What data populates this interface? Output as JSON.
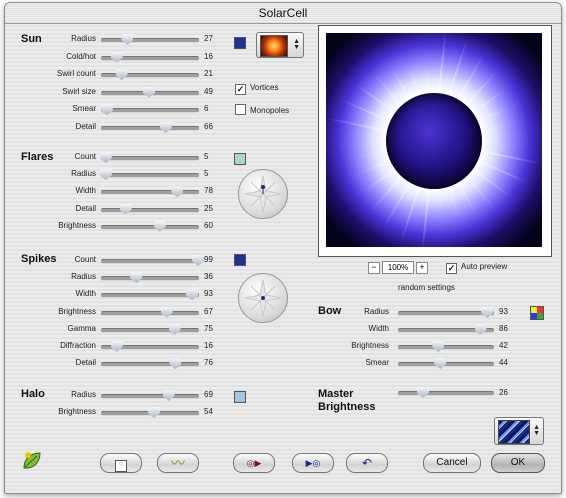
{
  "window": {
    "title": "SolarCell"
  },
  "sun": {
    "title": "Sun",
    "sliders": [
      {
        "label": "Radius",
        "value": "27",
        "level": 0.27
      },
      {
        "label": "Cold/hot",
        "value": "16",
        "level": 0.16
      },
      {
        "label": "Swirl count",
        "value": "21",
        "level": 0.21
      },
      {
        "label": "Swirl size",
        "value": "49",
        "level": 0.49
      },
      {
        "label": "Smear",
        "value": "6",
        "level": 0.06
      },
      {
        "label": "Detail",
        "value": "66",
        "level": 0.66
      }
    ],
    "swatch_color": "#1f2f9a",
    "vortices": {
      "label": "Vortices",
      "checked": true
    },
    "monopoles": {
      "label": "Monopoles",
      "checked": false
    }
  },
  "flares": {
    "title": "Flares",
    "sliders": [
      {
        "label": "Count",
        "value": "5",
        "level": 0.05
      },
      {
        "label": "Radius",
        "value": "5",
        "level": 0.05
      },
      {
        "label": "Width",
        "value": "78",
        "level": 0.78
      },
      {
        "label": "Detail",
        "value": "25",
        "level": 0.25
      },
      {
        "label": "Brightness",
        "value": "60",
        "level": 0.6
      }
    ],
    "swatch_color": "#a9d8c4"
  },
  "spikes": {
    "title": "Spikes",
    "sliders": [
      {
        "label": "Count",
        "value": "99",
        "level": 0.99
      },
      {
        "label": "Radius",
        "value": "36",
        "level": 0.36
      },
      {
        "label": "Width",
        "value": "93",
        "level": 0.93
      },
      {
        "label": "Brightness",
        "value": "67",
        "level": 0.67
      },
      {
        "label": "Gamma",
        "value": "75",
        "level": 0.75
      },
      {
        "label": "Diffraction",
        "value": "16",
        "level": 0.16
      },
      {
        "label": "Detail",
        "value": "76",
        "level": 0.76
      }
    ],
    "swatch_color": "#1f2f9a"
  },
  "halo": {
    "title": "Halo",
    "sliders": [
      {
        "label": "Radius",
        "value": "69",
        "level": 0.69
      },
      {
        "label": "Brightness",
        "value": "54",
        "level": 0.54
      }
    ],
    "swatch_color": "#9ec6e6"
  },
  "preview": {
    "zoom_minus": "−",
    "zoom": "100%",
    "zoom_plus": "+",
    "auto_preview": {
      "label": "Auto preview",
      "checked": true
    }
  },
  "bow": {
    "title": "Bow",
    "random_settings": "random settings",
    "sliders": [
      {
        "label": "Radius",
        "value": "93",
        "level": 0.93
      },
      {
        "label": "Width",
        "value": "86",
        "level": 0.86
      },
      {
        "label": "Brightness",
        "value": "42",
        "level": 0.42
      },
      {
        "label": "Smear",
        "value": "44",
        "level": 0.44
      }
    ]
  },
  "master": {
    "title_line1": "Master",
    "title_line2": "Brightness",
    "value": "26",
    "level": 0.26
  },
  "buttons": {
    "cancel": "Cancel",
    "ok": "OK"
  },
  "icons": {
    "plugin": "leaf-logo-icon",
    "random": "dice-icon",
    "wave": "wave-icon",
    "play_back": "reverse-play-icon",
    "play_forward": "play-forward-icon",
    "undo": "undo-arrow-icon",
    "random_bow": "colorful-grid-icon",
    "preset": "swirl-thumbnail-icon"
  }
}
